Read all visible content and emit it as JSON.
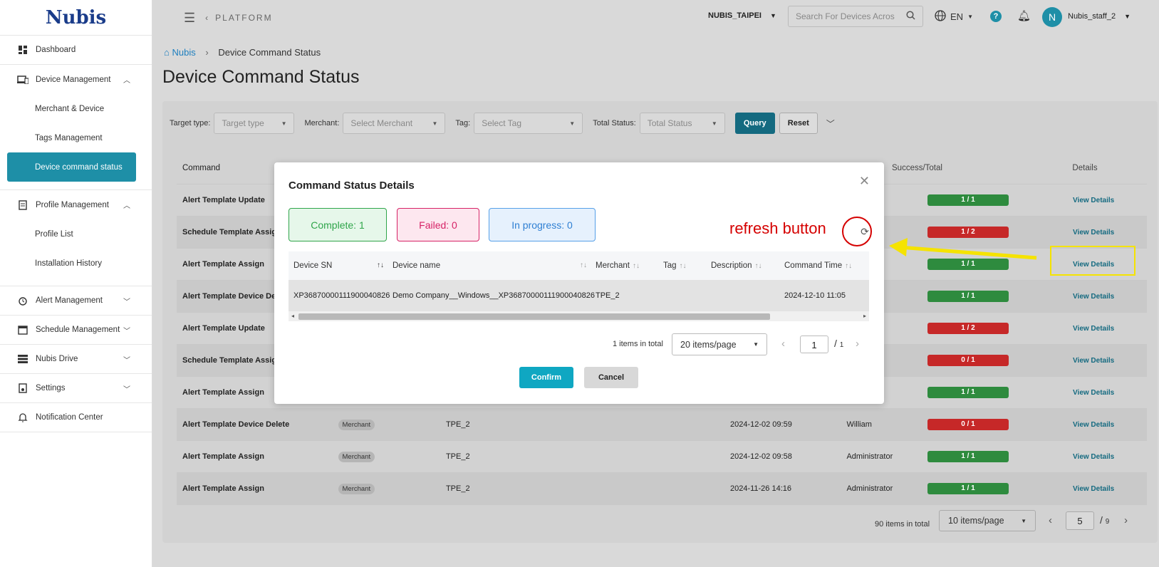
{
  "brand": {
    "logo_text": "Nubis"
  },
  "sidebar": {
    "dashboard": "Dashboard",
    "device_management": "Device Management",
    "merchant_device": "Merchant & Device",
    "tags_management": "Tags Management",
    "device_command_status": "Device command status",
    "profile_management": "Profile Management",
    "profile_list": "Profile List",
    "installation_history": "Installation History",
    "alert_management": "Alert Management",
    "schedule_management": "Schedule Management",
    "nubis_drive": "Nubis Drive",
    "settings": "Settings",
    "notification_center": "Notification Center"
  },
  "topbar": {
    "platform": "PLATFORM",
    "org": "NUBIS_TAIPEI",
    "search_placeholder": "Search For Devices Acros",
    "lang": "EN",
    "avatar_letter": "N",
    "username": "Nubis_staff_2"
  },
  "breadcrumb": {
    "home": "Nubis",
    "current": "Device Command Status"
  },
  "page_title": "Device Command Status",
  "filters": {
    "target_type_label": "Target type:",
    "target_type_placeholder": "Target type",
    "merchant_label": "Merchant:",
    "merchant_placeholder": "Select Merchant",
    "tag_label": "Tag:",
    "tag_placeholder": "Select Tag",
    "status_label": "Total Status:",
    "status_placeholder": "Total Status",
    "query": "Query",
    "reset": "Reset"
  },
  "table": {
    "headers": {
      "command": "Command",
      "success_total": "Success/Total",
      "details": "Details"
    },
    "rows": [
      {
        "command": "Alert Template Update",
        "target": "",
        "merchant": "",
        "time": "",
        "user": "",
        "ratio": "1 / 1",
        "status": "green",
        "details": "View Details"
      },
      {
        "command": "Schedule Template Assign",
        "target": "",
        "merchant": "",
        "time": "",
        "user": "",
        "ratio": "1 / 2",
        "status": "red",
        "details": "View Details"
      },
      {
        "command": "Alert Template Assign",
        "target": "",
        "merchant": "",
        "time": "",
        "user": "",
        "ratio": "1 / 1",
        "status": "green",
        "details": "View Details"
      },
      {
        "command": "Alert Template Device Delete",
        "target": "",
        "merchant": "",
        "time": "",
        "user": "",
        "ratio": "1 / 1",
        "status": "green",
        "details": "View Details"
      },
      {
        "command": "Alert Template Update",
        "target": "",
        "merchant": "",
        "time": "",
        "user": "",
        "ratio": "1 / 2",
        "status": "red",
        "details": "View Details"
      },
      {
        "command": "Schedule Template Assign",
        "target": "",
        "merchant": "",
        "time": "",
        "user": "",
        "ratio": "0 / 1",
        "status": "red",
        "details": "View Details"
      },
      {
        "command": "Alert Template Assign",
        "target": "",
        "merchant": "",
        "time": "",
        "user": "",
        "ratio": "1 / 1",
        "status": "green",
        "details": "View Details"
      },
      {
        "command": "Alert Template Device Delete",
        "target": "Merchant",
        "merchant": "TPE_2",
        "time": "2024-12-02 09:59",
        "user": "William",
        "ratio": "0 / 1",
        "status": "red",
        "details": "View Details"
      },
      {
        "command": "Alert Template Assign",
        "target": "Merchant",
        "merchant": "TPE_2",
        "time": "2024-12-02 09:58",
        "user": "Administrator",
        "ratio": "1 / 1",
        "status": "green",
        "details": "View Details"
      },
      {
        "command": "Alert Template Assign",
        "target": "Merchant",
        "merchant": "TPE_2",
        "time": "2024-11-26 14:16",
        "user": "Administrator",
        "ratio": "1 / 1",
        "status": "green",
        "details": "View Details"
      }
    ]
  },
  "pagination": {
    "total": "90 items in total",
    "page_size": "10 items/page",
    "current": "5",
    "of": "9"
  },
  "modal": {
    "title": "Command Status Details",
    "complete": "Complete: 1",
    "failed": "Failed: 0",
    "in_progress": "In progress: 0",
    "headers": {
      "device_sn": "Device SN",
      "device_name": "Device name",
      "merchant": "Merchant",
      "tag": "Tag",
      "description": "Description",
      "command_time": "Command Time"
    },
    "row": {
      "device_sn": "XP36870000111900040826",
      "device_name": "Demo Company__Windows__XP36870000111900040826",
      "merchant": "TPE_2",
      "tag": "",
      "description": "",
      "command_time": "2024-12-10 11:05"
    },
    "total": "1 items in total",
    "page_size": "20 items/page",
    "current": "1",
    "of": "1",
    "confirm": "Confirm",
    "cancel": "Cancel"
  },
  "annotation": {
    "label": "refresh button",
    "color": "#d50000",
    "highlight_color": "#f5e300"
  },
  "colors": {
    "accent": "#1e8fa7",
    "success": "#2e8b3e",
    "danger": "#c62828"
  }
}
